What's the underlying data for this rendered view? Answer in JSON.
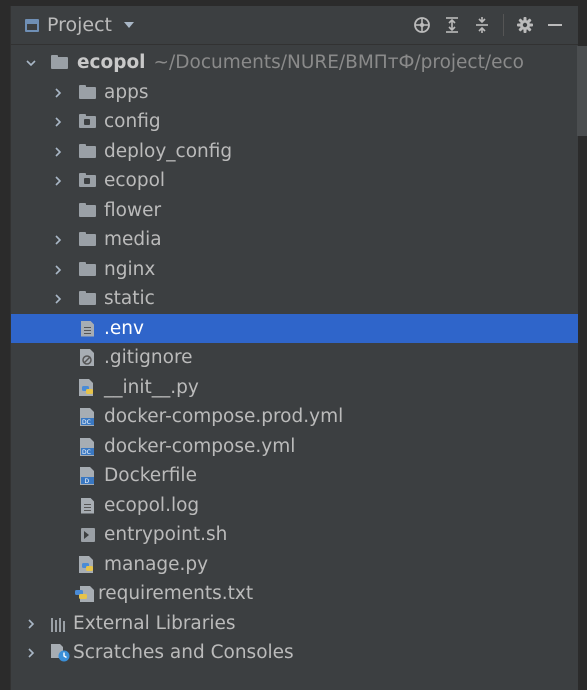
{
  "header": {
    "title": "Project",
    "tools": [
      "locate-icon",
      "expand-all-icon",
      "collapse-all-icon",
      "gear-icon",
      "hide-icon"
    ]
  },
  "tree": {
    "root": {
      "name": "ecopol",
      "path": "~/Documents/NURE/ВМПтФ/project/eco"
    },
    "items": [
      {
        "label": "apps",
        "icon": "folder-icon",
        "expandable": true
      },
      {
        "label": "config",
        "icon": "package-folder-icon",
        "expandable": true
      },
      {
        "label": "deploy_config",
        "icon": "folder-icon",
        "expandable": true
      },
      {
        "label": "ecopol",
        "icon": "package-folder-icon",
        "expandable": true
      },
      {
        "label": "flower",
        "icon": "folder-icon",
        "expandable": false
      },
      {
        "label": "media",
        "icon": "folder-icon",
        "expandable": true
      },
      {
        "label": "nginx",
        "icon": "folder-icon",
        "expandable": true
      },
      {
        "label": "static",
        "icon": "folder-icon",
        "expandable": true
      },
      {
        "label": ".env",
        "icon": "text-file-icon",
        "selected": true
      },
      {
        "label": ".gitignore",
        "icon": "gitignore-file-icon"
      },
      {
        "label": "__init__.py",
        "icon": "python-file-icon"
      },
      {
        "label": "docker-compose.prod.yml",
        "icon": "docker-compose-file-icon"
      },
      {
        "label": "docker-compose.yml",
        "icon": "docker-compose-file-icon"
      },
      {
        "label": "Dockerfile",
        "icon": "dockerfile-icon"
      },
      {
        "label": "ecopol.log",
        "icon": "text-file-icon"
      },
      {
        "label": "entrypoint.sh",
        "icon": "shell-script-icon"
      },
      {
        "label": "manage.py",
        "icon": "python-file-icon"
      },
      {
        "label": "requirements.txt",
        "icon": "requirements-file-icon"
      }
    ],
    "bottom": [
      {
        "label": "External Libraries",
        "icon": "libraries-icon"
      },
      {
        "label": "Scratches and Consoles",
        "icon": "scratches-icon"
      }
    ]
  },
  "colors": {
    "panel_bg": "#3c3f41",
    "selection": "#2f65ca",
    "text": "#bbbbbb",
    "folder": "#9aa0a6"
  }
}
